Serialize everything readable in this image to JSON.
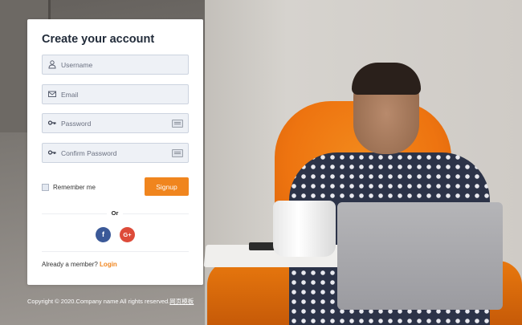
{
  "form": {
    "title": "Create your account",
    "fields": [
      {
        "icon": "user-icon",
        "placeholder": "Username",
        "value": ""
      },
      {
        "icon": "envelope-icon",
        "placeholder": "Email",
        "value": ""
      },
      {
        "icon": "key-icon",
        "placeholder": "Password",
        "value": ""
      },
      {
        "icon": "key-icon",
        "placeholder": "Confirm Password",
        "value": ""
      }
    ],
    "remember_label": "Remember me",
    "signup_label": "Signup",
    "or_label": "Or",
    "social": [
      {
        "icon": "facebook-icon",
        "glyph": "f",
        "color": "#3b5998"
      },
      {
        "icon": "google-plus-icon",
        "glyph": "G+",
        "color": "#dd4b39"
      }
    ],
    "already_text": "Already a member?",
    "login_label": "Login"
  },
  "footer": {
    "copyright": "Copyright © 2020.Company name All rights reserved.",
    "link": "网页模板"
  },
  "colors": {
    "accent": "#f0851e",
    "title": "#222c3a",
    "field_bg": "#eef1f6"
  }
}
